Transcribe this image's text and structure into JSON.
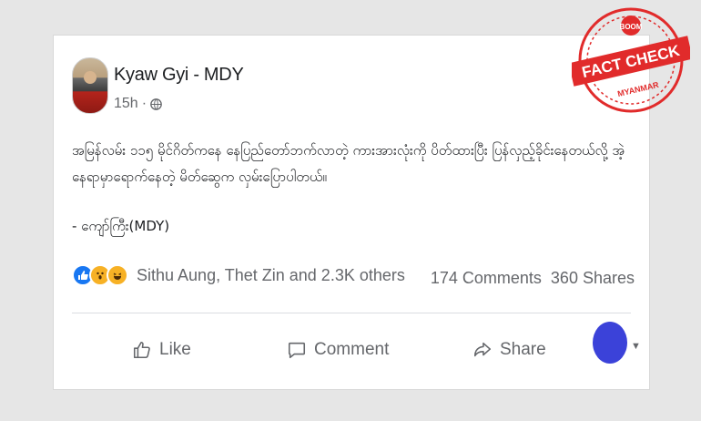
{
  "post": {
    "author": "Kyaw Gyi - MDY",
    "timestamp": "15h",
    "separator": "·",
    "body": "အမြန်လမ်း ၁၁၅ မိုင်ဂိတ်ကနေ နေပြည်တော်ဘက်လာတဲ့ ကားအားလုံးကို ပိတ်ထားပြီး ပြန်လှည့်ခိုင်းနေတယ်လို့ အဲ့နေရာမှာရောက်နေတဲ့ မိတ်ဆွေက လှမ်းပြောပါတယ်။",
    "signature": "- ကျော်ကြီး(MDY)"
  },
  "reactions": {
    "icons": [
      "like-icon",
      "wow-icon",
      "haha-icon"
    ],
    "names": "Sithu Aung, Thet Zin and 2.3K others",
    "comments": "174 Comments",
    "shares": "360 Shares"
  },
  "actions": {
    "like": "Like",
    "comment": "Comment",
    "share": "Share"
  },
  "stamp": {
    "top": "BOOM",
    "main": "FACT CHECK",
    "bottom": "MYANMAR",
    "color": "#e12b2b"
  }
}
